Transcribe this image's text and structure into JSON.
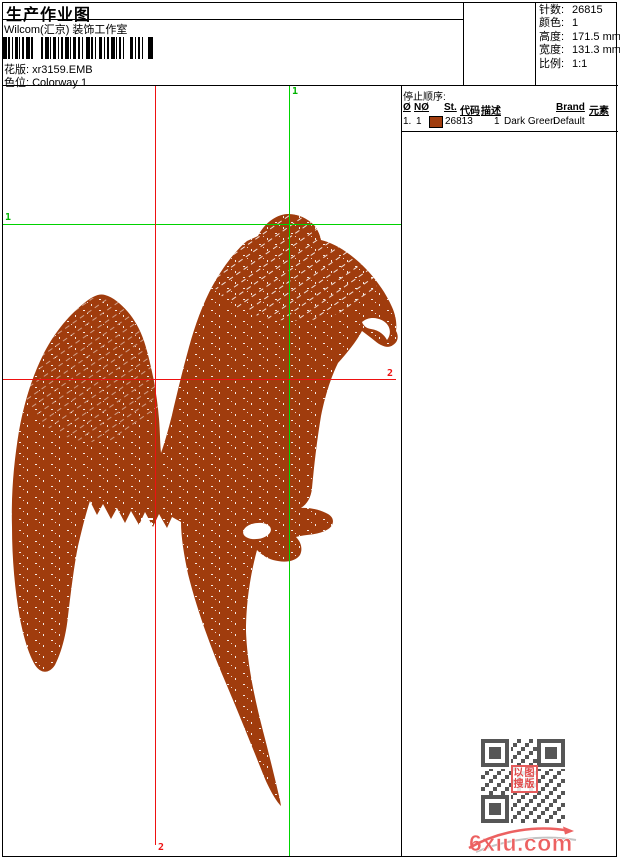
{
  "header": {
    "title": "生产作业图",
    "subtitle": "Wilcom(汇京) 装饰工作室",
    "pattern_label": "花版:",
    "pattern_value": "xr3159.EMB",
    "colorway_label": "色位:",
    "colorway_value": "Colorway 1"
  },
  "info": {
    "rows": [
      {
        "label": "针数:",
        "value": "26815"
      },
      {
        "label": "颜色:",
        "value": "1"
      },
      {
        "label": "高度:",
        "value": "171.5 mm"
      },
      {
        "label": "宽度:",
        "value": "131.3 mm"
      },
      {
        "label": "比例:",
        "value": "1:1"
      }
    ]
  },
  "stop_table": {
    "title": "停止顺序:",
    "columns": [
      "Ø",
      "NØ",
      "St.",
      "代码",
      "描述",
      "Brand",
      "元素"
    ],
    "rows": [
      {
        "seq": "1.",
        "needle": "1",
        "swatch_color": "#a03c0d",
        "stitches": "26813",
        "code": "1",
        "description": "Dark Green",
        "brand": "Default"
      }
    ]
  },
  "design": {
    "subject": "parrot embroidery stitch preview",
    "thread_color": "#a03c0d",
    "guide_labels": {
      "green_top": "1",
      "green_left": "1",
      "red_right": "2",
      "red_bottom": "2"
    }
  },
  "watermark": {
    "stamp_line1": "以图",
    "stamp_line2": "搜版",
    "logo_text": "6xiu.com"
  },
  "colors": {
    "guide_green": "#00d300",
    "guide_red": "#ee1111",
    "thread_brown": "#a03c0d",
    "qr_gray": "#565656",
    "stamp_red": "#e04848",
    "logo_red": "#ec6161"
  }
}
